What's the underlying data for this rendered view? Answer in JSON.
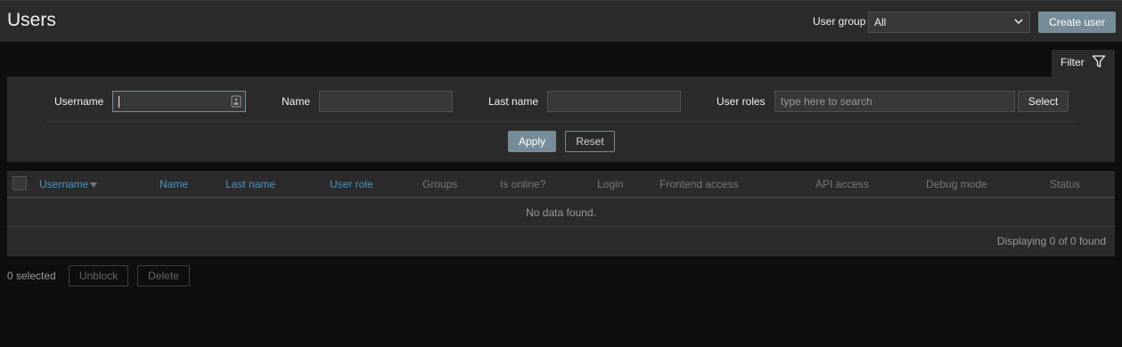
{
  "header": {
    "title": "Users",
    "user_group_label": "User group",
    "user_group_value": "All",
    "create_user_label": "Create user"
  },
  "filter": {
    "tab_label": "Filter",
    "username_label": "Username",
    "username_value": "",
    "name_label": "Name",
    "name_value": "",
    "last_name_label": "Last name",
    "last_name_value": "",
    "user_roles_label": "User roles",
    "user_roles_placeholder": "type here to search",
    "select_label": "Select",
    "apply_label": "Apply",
    "reset_label": "Reset"
  },
  "table": {
    "columns": [
      "Username",
      "Name",
      "Last name",
      "User role",
      "Groups",
      "Is online?",
      "Login",
      "Frontend access",
      "API access",
      "Debug mode",
      "Status"
    ],
    "no_data": "No data found.",
    "displaying": "Displaying 0 of 0 found"
  },
  "actions": {
    "selected": "0 selected",
    "unblock_label": "Unblock",
    "delete_label": "Delete"
  },
  "colors": {
    "accent": "#768d99",
    "link": "#4796c4",
    "background": "#0e0e0e",
    "panel": "#2b2b2b"
  }
}
